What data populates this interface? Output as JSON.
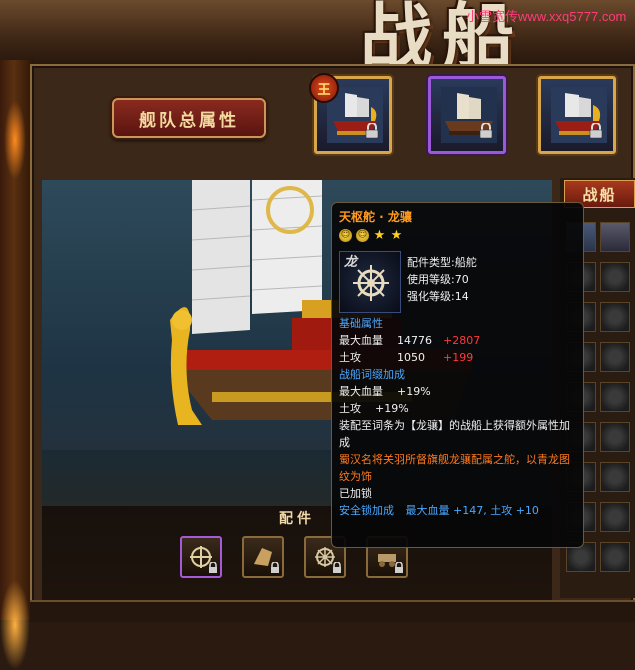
{
  "banner": {
    "title": "战船",
    "watermark": "小雪宽传www.xxq5777.com"
  },
  "fleet": {
    "button_label": "舰队总属性",
    "crown_badge": "王"
  },
  "side_panel": {
    "header": "战船"
  },
  "parts": {
    "title": "配件"
  },
  "tooltip": {
    "name": "天枢舵 · 龙骧",
    "icon_char": "龙",
    "meta": {
      "type_label": "配件类型:",
      "type_value": "船舵",
      "level_label": "使用等级:",
      "level_value": "70",
      "enhance_label": "强化等级:",
      "enhance_value": "14"
    },
    "base_section": "基础属性",
    "base_stats": [
      {
        "label": "最大血量",
        "value": "14776",
        "bonus": "+2807"
      },
      {
        "label": "土攻",
        "value": "1050",
        "bonus": "+199"
      }
    ],
    "ship_section": "战船词缀加成",
    "ship_stats": [
      {
        "label": "最大血量",
        "value": "+19%"
      },
      {
        "label": "土攻",
        "value": "+19%"
      }
    ],
    "equip_desc": "装配至词条为【龙骧】的战船上获得额外属性加成",
    "lore": "蜀汉名将关羽所督旗舰龙骧配属之舵，以青龙图纹为饰",
    "locked_text": "已加锁",
    "lock_bonus_label": "安全锁加成",
    "lock_bonus_value": "最大血量 +147, 土攻 +10"
  },
  "colors": {
    "tooltip_title": "#ff9a1e",
    "section_blue": "#4aa8ff",
    "bonus_red": "#ff3a3a",
    "lore_orange": "#ff7a1e",
    "frame_gold": "#d7a64a"
  }
}
